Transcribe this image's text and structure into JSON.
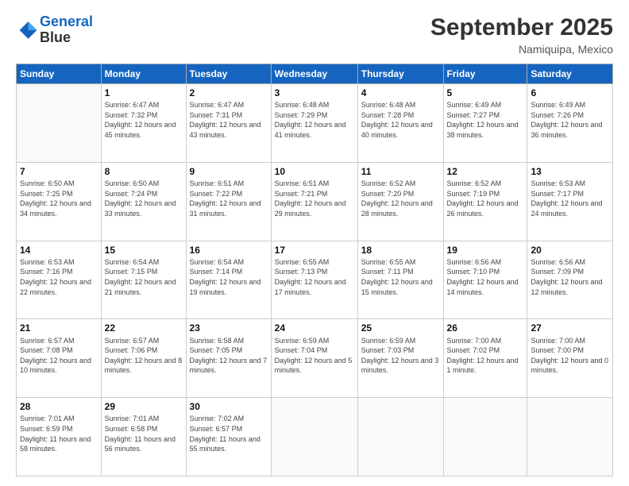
{
  "header": {
    "logo_line1": "General",
    "logo_line2": "Blue",
    "month_title": "September 2025",
    "location": "Namiquipa, Mexico"
  },
  "weekdays": [
    "Sunday",
    "Monday",
    "Tuesday",
    "Wednesday",
    "Thursday",
    "Friday",
    "Saturday"
  ],
  "weeks": [
    [
      {
        "day": "",
        "info": ""
      },
      {
        "day": "1",
        "info": "Sunrise: 6:47 AM\nSunset: 7:32 PM\nDaylight: 12 hours\nand 45 minutes."
      },
      {
        "day": "2",
        "info": "Sunrise: 6:47 AM\nSunset: 7:31 PM\nDaylight: 12 hours\nand 43 minutes."
      },
      {
        "day": "3",
        "info": "Sunrise: 6:48 AM\nSunset: 7:29 PM\nDaylight: 12 hours\nand 41 minutes."
      },
      {
        "day": "4",
        "info": "Sunrise: 6:48 AM\nSunset: 7:28 PM\nDaylight: 12 hours\nand 40 minutes."
      },
      {
        "day": "5",
        "info": "Sunrise: 6:49 AM\nSunset: 7:27 PM\nDaylight: 12 hours\nand 38 minutes."
      },
      {
        "day": "6",
        "info": "Sunrise: 6:49 AM\nSunset: 7:26 PM\nDaylight: 12 hours\nand 36 minutes."
      }
    ],
    [
      {
        "day": "7",
        "info": "Sunrise: 6:50 AM\nSunset: 7:25 PM\nDaylight: 12 hours\nand 34 minutes."
      },
      {
        "day": "8",
        "info": "Sunrise: 6:50 AM\nSunset: 7:24 PM\nDaylight: 12 hours\nand 33 minutes."
      },
      {
        "day": "9",
        "info": "Sunrise: 6:51 AM\nSunset: 7:22 PM\nDaylight: 12 hours\nand 31 minutes."
      },
      {
        "day": "10",
        "info": "Sunrise: 6:51 AM\nSunset: 7:21 PM\nDaylight: 12 hours\nand 29 minutes."
      },
      {
        "day": "11",
        "info": "Sunrise: 6:52 AM\nSunset: 7:20 PM\nDaylight: 12 hours\nand 28 minutes."
      },
      {
        "day": "12",
        "info": "Sunrise: 6:52 AM\nSunset: 7:19 PM\nDaylight: 12 hours\nand 26 minutes."
      },
      {
        "day": "13",
        "info": "Sunrise: 6:53 AM\nSunset: 7:17 PM\nDaylight: 12 hours\nand 24 minutes."
      }
    ],
    [
      {
        "day": "14",
        "info": "Sunrise: 6:53 AM\nSunset: 7:16 PM\nDaylight: 12 hours\nand 22 minutes."
      },
      {
        "day": "15",
        "info": "Sunrise: 6:54 AM\nSunset: 7:15 PM\nDaylight: 12 hours\nand 21 minutes."
      },
      {
        "day": "16",
        "info": "Sunrise: 6:54 AM\nSunset: 7:14 PM\nDaylight: 12 hours\nand 19 minutes."
      },
      {
        "day": "17",
        "info": "Sunrise: 6:55 AM\nSunset: 7:13 PM\nDaylight: 12 hours\nand 17 minutes."
      },
      {
        "day": "18",
        "info": "Sunrise: 6:55 AM\nSunset: 7:11 PM\nDaylight: 12 hours\nand 15 minutes."
      },
      {
        "day": "19",
        "info": "Sunrise: 6:56 AM\nSunset: 7:10 PM\nDaylight: 12 hours\nand 14 minutes."
      },
      {
        "day": "20",
        "info": "Sunrise: 6:56 AM\nSunset: 7:09 PM\nDaylight: 12 hours\nand 12 minutes."
      }
    ],
    [
      {
        "day": "21",
        "info": "Sunrise: 6:57 AM\nSunset: 7:08 PM\nDaylight: 12 hours\nand 10 minutes."
      },
      {
        "day": "22",
        "info": "Sunrise: 6:57 AM\nSunset: 7:06 PM\nDaylight: 12 hours\nand 8 minutes."
      },
      {
        "day": "23",
        "info": "Sunrise: 6:58 AM\nSunset: 7:05 PM\nDaylight: 12 hours\nand 7 minutes."
      },
      {
        "day": "24",
        "info": "Sunrise: 6:59 AM\nSunset: 7:04 PM\nDaylight: 12 hours\nand 5 minutes."
      },
      {
        "day": "25",
        "info": "Sunrise: 6:59 AM\nSunset: 7:03 PM\nDaylight: 12 hours\nand 3 minutes."
      },
      {
        "day": "26",
        "info": "Sunrise: 7:00 AM\nSunset: 7:02 PM\nDaylight: 12 hours\nand 1 minute."
      },
      {
        "day": "27",
        "info": "Sunrise: 7:00 AM\nSunset: 7:00 PM\nDaylight: 12 hours\nand 0 minutes."
      }
    ],
    [
      {
        "day": "28",
        "info": "Sunrise: 7:01 AM\nSunset: 6:59 PM\nDaylight: 11 hours\nand 58 minutes."
      },
      {
        "day": "29",
        "info": "Sunrise: 7:01 AM\nSunset: 6:58 PM\nDaylight: 11 hours\nand 56 minutes."
      },
      {
        "day": "30",
        "info": "Sunrise: 7:02 AM\nSunset: 6:57 PM\nDaylight: 11 hours\nand 55 minutes."
      },
      {
        "day": "",
        "info": ""
      },
      {
        "day": "",
        "info": ""
      },
      {
        "day": "",
        "info": ""
      },
      {
        "day": "",
        "info": ""
      }
    ]
  ]
}
